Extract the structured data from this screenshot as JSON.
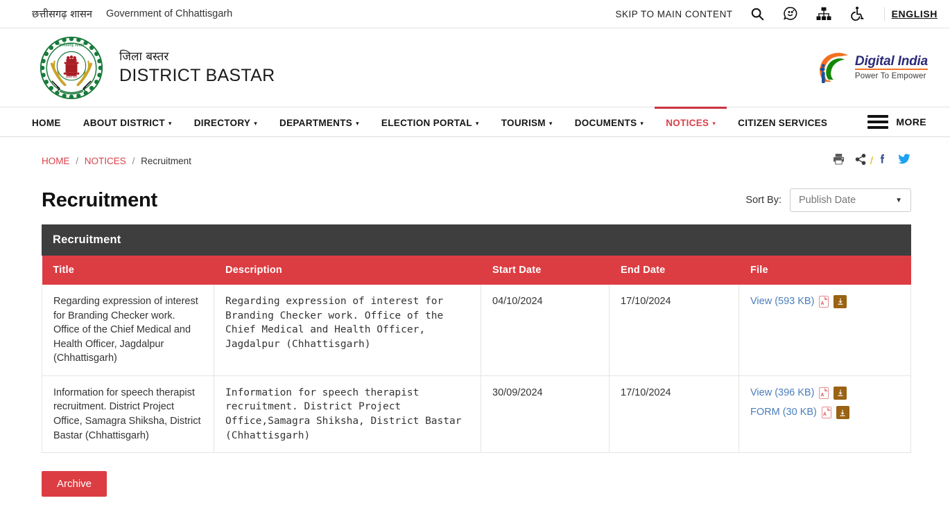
{
  "topbar": {
    "gov_hindi": "छत्तीसगढ़ शासन",
    "gov_english": "Government of Chhattisgarh",
    "skip_link": "SKIP TO MAIN CONTENT",
    "icons": [
      "search-icon",
      "accessibility-speech-icon",
      "sitemap-icon",
      "accessibility-wheelchair-icon"
    ],
    "language": "ENGLISH"
  },
  "masthead": {
    "emblem_alt": "chhattisgarh-state-emblem",
    "title_hindi": "जिला बस्तर",
    "title_english": "DISTRICT BASTAR",
    "digital_india_name": "Digital India",
    "digital_india_tagline": "Power To Empower"
  },
  "nav": {
    "items": [
      {
        "label": "HOME",
        "has_caret": false,
        "active": false
      },
      {
        "label": "ABOUT DISTRICT",
        "has_caret": true,
        "active": false
      },
      {
        "label": "DIRECTORY",
        "has_caret": true,
        "active": false
      },
      {
        "label": "DEPARTMENTS",
        "has_caret": true,
        "active": false
      },
      {
        "label": "ELECTION PORTAL",
        "has_caret": true,
        "active": false
      },
      {
        "label": "TOURISM",
        "has_caret": true,
        "active": false
      },
      {
        "label": "DOCUMENTS",
        "has_caret": true,
        "active": false
      },
      {
        "label": "NOTICES",
        "has_caret": true,
        "active": true
      },
      {
        "label": "CITIZEN SERVICES",
        "has_caret": false,
        "active": false
      }
    ],
    "more_label": "MORE"
  },
  "breadcrumb": {
    "home": "HOME",
    "notices": "NOTICES",
    "current": "Recruitment",
    "separator": "/"
  },
  "share": {
    "icons": [
      "print-icon",
      "share-icon",
      "facebook-icon",
      "twitter-icon"
    ],
    "slash": "/"
  },
  "page": {
    "title": "Recruitment",
    "sort_label": "Sort By:",
    "sort_value": "Publish Date"
  },
  "table": {
    "caption": "Recruitment",
    "columns": [
      "Title",
      "Description",
      "Start Date",
      "End Date",
      "File"
    ],
    "rows": [
      {
        "title": "Regarding expression of interest for Branding Checker work. Office of the Chief Medical and Health Officer, Jagdalpur (Chhattisgarh)",
        "description": "Regarding expression of interest for Branding Checker work. Office of the Chief Medical and Health Officer, Jagdalpur (Chhattisgarh)",
        "start_date": "04/10/2024",
        "end_date": "17/10/2024",
        "files": [
          {
            "label": "View (593 KB)"
          }
        ]
      },
      {
        "title": "Information for speech therapist recruitment. District Project Office, Samagra Shiksha, District Bastar (Chhattisgarh)",
        "description": "Information for speech therapist recruitment. District Project Office,Samagra Shiksha, District Bastar (Chhattisgarh)",
        "start_date": "30/09/2024",
        "end_date": "17/10/2024",
        "files": [
          {
            "label": "View (396 KB)"
          },
          {
            "label": "FORM (30 KB)"
          }
        ]
      }
    ]
  },
  "footer_actions": {
    "archive_label": "Archive"
  },
  "colors": {
    "accent_red": "#dc3d42",
    "caption_dark": "#3e3e3e",
    "link_blue": "#4a7ebb",
    "download_brown": "#9a6213",
    "crumb_red": "#d9414a"
  }
}
